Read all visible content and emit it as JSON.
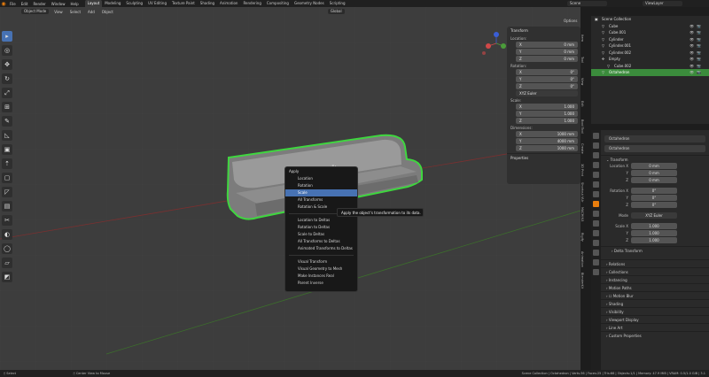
{
  "topbar": {
    "menu": [
      "File",
      "Edit",
      "Render",
      "Window",
      "Help"
    ],
    "workspaces": [
      "Layout",
      "Modeling",
      "Sculpting",
      "UV Editing",
      "Texture Paint",
      "Shading",
      "Animation",
      "Rendering",
      "Compositing",
      "Geometry Nodes",
      "Scripting"
    ],
    "active_workspace": "Layout",
    "scene": "Scene",
    "view_layer": "ViewLayer"
  },
  "viewport_header": {
    "mode": "Object Mode",
    "menus": [
      "View",
      "Select",
      "Add",
      "Object"
    ],
    "orientation": "Global",
    "options_label": "Options"
  },
  "toolbar_icons": [
    "select-box-icon",
    "cursor-icon",
    "move-icon",
    "rotate-icon",
    "scale-icon",
    "transform-icon",
    "annotate-icon",
    "measure-icon",
    "add-cube-icon",
    "extrude-icon",
    "inset-icon",
    "bevel-icon",
    "loop-cut-icon",
    "knife-icon",
    "poly-build-icon",
    "spin-icon",
    "smooth-icon",
    "shrink-icon",
    "shear-icon",
    "rip-icon"
  ],
  "npanel": {
    "title": "Transform",
    "location_label": "Location:",
    "location": [
      {
        "axis": "X",
        "value": "0 mm"
      },
      {
        "axis": "Y",
        "value": "0 mm"
      },
      {
        "axis": "Z",
        "value": "0 mm"
      }
    ],
    "rotation_label": "Rotation:",
    "rotation": [
      {
        "axis": "X",
        "value": "0°"
      },
      {
        "axis": "Y",
        "value": "0°"
      },
      {
        "axis": "Z",
        "value": "0°"
      }
    ],
    "rotation_mode": "XYZ Euler",
    "scale_label": "Scale:",
    "scale": [
      {
        "axis": "X",
        "value": "1.000"
      },
      {
        "axis": "Y",
        "value": "1.000"
      },
      {
        "axis": "Z",
        "value": "1.000"
      }
    ],
    "dimensions_label": "Dimensions:",
    "dimensions": [
      {
        "axis": "X",
        "value": "1000 mm"
      },
      {
        "axis": "Y",
        "value": "4000 mm"
      },
      {
        "axis": "Z",
        "value": "1000 mm"
      }
    ],
    "properties_label": "Properties",
    "tabs": [
      "Item",
      "Tool",
      "View",
      "Edit",
      "Bool Tool",
      "Create",
      "3D Print",
      "Shortcut VUr",
      "MACHIN3",
      "Rigify",
      "Animation",
      "BlenderKit",
      "Edit",
      "HardOps",
      "Screencast",
      "DECALmachine"
    ]
  },
  "outliner": {
    "root": "Scene Collection",
    "rows": [
      {
        "name": "Cube",
        "selected": false
      },
      {
        "name": "Cube.001",
        "selected": false
      },
      {
        "name": "Cylinder",
        "selected": false
      },
      {
        "name": "Cylinder.001",
        "selected": false
      },
      {
        "name": "Cylinder.002",
        "selected": false
      },
      {
        "name": "Empty",
        "selected": false
      },
      {
        "name": "Cube.002",
        "selected": false
      },
      {
        "name": "Octahedron",
        "selected": true
      }
    ]
  },
  "properties": {
    "object_name": "Octahedron",
    "object_name_field": "Octahedron",
    "transform_label": "Transform",
    "location_label": "Location X",
    "location": [
      "0 mm",
      "0 mm",
      "0 mm"
    ],
    "rotation_label": "Rotation X",
    "rotation": [
      "0°",
      "0°",
      "0°"
    ],
    "mode_label": "Mode",
    "mode": "XYZ Euler",
    "scale_label": "Scale X",
    "scale": [
      "1.000",
      "1.000",
      "1.000"
    ],
    "axis_labels": [
      "Y",
      "Z"
    ],
    "sections": [
      "Delta Transform",
      "Relations",
      "Collections",
      "Instancing",
      "Motion Paths",
      "Motion Blur",
      "Shading",
      "Visibility",
      "Viewport Display",
      "Line Art",
      "Custom Properties"
    ]
  },
  "context_menu": {
    "title": "Apply",
    "group1": [
      "Location",
      "Rotation",
      "Scale",
      "All Transforms",
      "Rotation & Scale"
    ],
    "highlighted": "Scale",
    "group2": [
      "Location to Deltas",
      "Rotation to Deltas",
      "Scale to Deltas",
      "All Transforms to Deltas",
      "Animated Transforms to Deltas"
    ],
    "group3": [
      "Visual Transform",
      "Visual Geometry to Mesh",
      "Make Instances Real",
      "Parent Inverse"
    ]
  },
  "tooltip": "Apply the object's transformation to its data.",
  "statusbar": {
    "left": "Select",
    "middle": "Center View to Mouse",
    "right": "Scene Collection | Octahedron | Verts:36 | Faces:25 | Tris:66 | Objects:1/1 | Memory: 47.9 MiB | VRAM: 0.5/1.0 GiB | 3.1"
  },
  "colors": {
    "accent": "#4772b3",
    "selection_outline": "#3fd63f",
    "outliner_selected": "#3b8c3c",
    "viewport_bg": "#3d3d3d"
  }
}
